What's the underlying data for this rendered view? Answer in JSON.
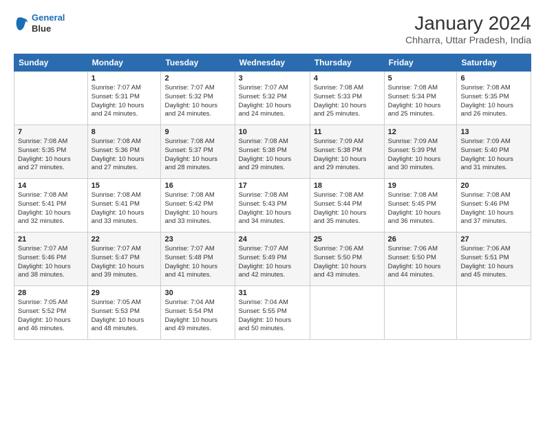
{
  "header": {
    "logo_line1": "General",
    "logo_line2": "Blue",
    "title": "January 2024",
    "subtitle": "Chharra, Uttar Pradesh, India"
  },
  "days_of_week": [
    "Sunday",
    "Monday",
    "Tuesday",
    "Wednesday",
    "Thursday",
    "Friday",
    "Saturday"
  ],
  "weeks": [
    [
      {
        "num": "",
        "info": ""
      },
      {
        "num": "1",
        "info": "Sunrise: 7:07 AM\nSunset: 5:31 PM\nDaylight: 10 hours\nand 24 minutes."
      },
      {
        "num": "2",
        "info": "Sunrise: 7:07 AM\nSunset: 5:32 PM\nDaylight: 10 hours\nand 24 minutes."
      },
      {
        "num": "3",
        "info": "Sunrise: 7:07 AM\nSunset: 5:32 PM\nDaylight: 10 hours\nand 24 minutes."
      },
      {
        "num": "4",
        "info": "Sunrise: 7:08 AM\nSunset: 5:33 PM\nDaylight: 10 hours\nand 25 minutes."
      },
      {
        "num": "5",
        "info": "Sunrise: 7:08 AM\nSunset: 5:34 PM\nDaylight: 10 hours\nand 25 minutes."
      },
      {
        "num": "6",
        "info": "Sunrise: 7:08 AM\nSunset: 5:35 PM\nDaylight: 10 hours\nand 26 minutes."
      }
    ],
    [
      {
        "num": "7",
        "info": "Sunrise: 7:08 AM\nSunset: 5:35 PM\nDaylight: 10 hours\nand 27 minutes."
      },
      {
        "num": "8",
        "info": "Sunrise: 7:08 AM\nSunset: 5:36 PM\nDaylight: 10 hours\nand 27 minutes."
      },
      {
        "num": "9",
        "info": "Sunrise: 7:08 AM\nSunset: 5:37 PM\nDaylight: 10 hours\nand 28 minutes."
      },
      {
        "num": "10",
        "info": "Sunrise: 7:08 AM\nSunset: 5:38 PM\nDaylight: 10 hours\nand 29 minutes."
      },
      {
        "num": "11",
        "info": "Sunrise: 7:09 AM\nSunset: 5:38 PM\nDaylight: 10 hours\nand 29 minutes."
      },
      {
        "num": "12",
        "info": "Sunrise: 7:09 AM\nSunset: 5:39 PM\nDaylight: 10 hours\nand 30 minutes."
      },
      {
        "num": "13",
        "info": "Sunrise: 7:09 AM\nSunset: 5:40 PM\nDaylight: 10 hours\nand 31 minutes."
      }
    ],
    [
      {
        "num": "14",
        "info": "Sunrise: 7:08 AM\nSunset: 5:41 PM\nDaylight: 10 hours\nand 32 minutes."
      },
      {
        "num": "15",
        "info": "Sunrise: 7:08 AM\nSunset: 5:41 PM\nDaylight: 10 hours\nand 33 minutes."
      },
      {
        "num": "16",
        "info": "Sunrise: 7:08 AM\nSunset: 5:42 PM\nDaylight: 10 hours\nand 33 minutes."
      },
      {
        "num": "17",
        "info": "Sunrise: 7:08 AM\nSunset: 5:43 PM\nDaylight: 10 hours\nand 34 minutes."
      },
      {
        "num": "18",
        "info": "Sunrise: 7:08 AM\nSunset: 5:44 PM\nDaylight: 10 hours\nand 35 minutes."
      },
      {
        "num": "19",
        "info": "Sunrise: 7:08 AM\nSunset: 5:45 PM\nDaylight: 10 hours\nand 36 minutes."
      },
      {
        "num": "20",
        "info": "Sunrise: 7:08 AM\nSunset: 5:46 PM\nDaylight: 10 hours\nand 37 minutes."
      }
    ],
    [
      {
        "num": "21",
        "info": "Sunrise: 7:07 AM\nSunset: 5:46 PM\nDaylight: 10 hours\nand 38 minutes."
      },
      {
        "num": "22",
        "info": "Sunrise: 7:07 AM\nSunset: 5:47 PM\nDaylight: 10 hours\nand 39 minutes."
      },
      {
        "num": "23",
        "info": "Sunrise: 7:07 AM\nSunset: 5:48 PM\nDaylight: 10 hours\nand 41 minutes."
      },
      {
        "num": "24",
        "info": "Sunrise: 7:07 AM\nSunset: 5:49 PM\nDaylight: 10 hours\nand 42 minutes."
      },
      {
        "num": "25",
        "info": "Sunrise: 7:06 AM\nSunset: 5:50 PM\nDaylight: 10 hours\nand 43 minutes."
      },
      {
        "num": "26",
        "info": "Sunrise: 7:06 AM\nSunset: 5:50 PM\nDaylight: 10 hours\nand 44 minutes."
      },
      {
        "num": "27",
        "info": "Sunrise: 7:06 AM\nSunset: 5:51 PM\nDaylight: 10 hours\nand 45 minutes."
      }
    ],
    [
      {
        "num": "28",
        "info": "Sunrise: 7:05 AM\nSunset: 5:52 PM\nDaylight: 10 hours\nand 46 minutes."
      },
      {
        "num": "29",
        "info": "Sunrise: 7:05 AM\nSunset: 5:53 PM\nDaylight: 10 hours\nand 48 minutes."
      },
      {
        "num": "30",
        "info": "Sunrise: 7:04 AM\nSunset: 5:54 PM\nDaylight: 10 hours\nand 49 minutes."
      },
      {
        "num": "31",
        "info": "Sunrise: 7:04 AM\nSunset: 5:55 PM\nDaylight: 10 hours\nand 50 minutes."
      },
      {
        "num": "",
        "info": ""
      },
      {
        "num": "",
        "info": ""
      },
      {
        "num": "",
        "info": ""
      }
    ]
  ]
}
